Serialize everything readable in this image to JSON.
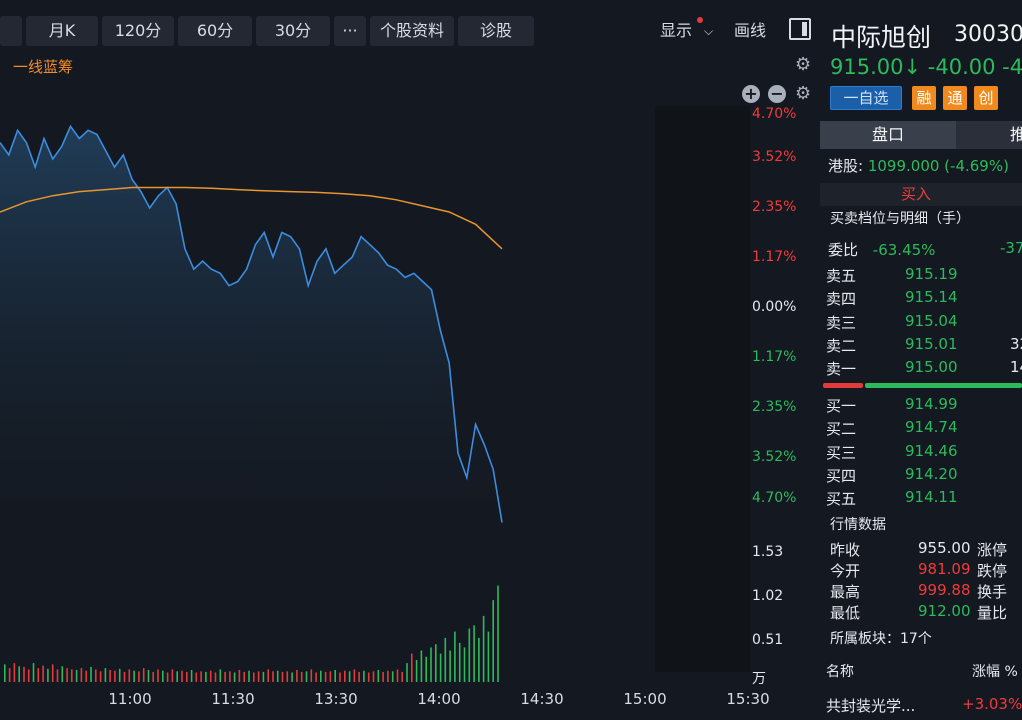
{
  "toolbar": {
    "buttons": [
      "月K",
      "120分",
      "60分",
      "30分",
      "···",
      "个股资料",
      "诊股"
    ],
    "display_label": "显示",
    "draw_label": "画线"
  },
  "chart": {
    "indicator_label": "一线蓝筹",
    "pct_labels": [
      {
        "text": "4.70%",
        "color": "red"
      },
      {
        "text": "3.52%",
        "color": "red"
      },
      {
        "text": "2.35%",
        "color": "red"
      },
      {
        "text": "1.17%",
        "color": "red"
      },
      {
        "text": "0.00%",
        "color": "white"
      },
      {
        "text": "1.17%",
        "color": "green"
      },
      {
        "text": "2.35%",
        "color": "green"
      },
      {
        "text": "3.52%",
        "color": "green"
      },
      {
        "text": "4.70%",
        "color": "green"
      }
    ],
    "volume_labels": [
      "1.53",
      "1.02",
      "0.51",
      "万"
    ],
    "time_labels": [
      "11:00",
      "11:30",
      "13:30",
      "14:00",
      "14:30",
      "15:00",
      "15:30"
    ]
  },
  "chart_data": {
    "type": "line",
    "title": "",
    "xlabel": "",
    "ylabel": "",
    "y_unit": "%",
    "ylim": [
      -4.7,
      4.7
    ],
    "x_ticks": [
      "11:00",
      "11:30",
      "13:30",
      "14:00",
      "14:30",
      "15:00",
      "15:30"
    ],
    "y_ticks": [
      4.7,
      3.52,
      2.35,
      1.17,
      0.0,
      -1.17,
      -2.35,
      -3.52,
      -4.7
    ],
    "series": [
      {
        "color": "#3b8de0",
        "values": [
          4.0,
          3.7,
          4.3,
          4.0,
          3.4,
          4.1,
          3.6,
          3.9,
          4.4,
          4.1,
          4.3,
          4.2,
          3.8,
          3.4,
          3.7,
          3.1,
          2.8,
          2.4,
          2.7,
          2.9,
          2.5,
          1.4,
          0.9,
          1.1,
          0.9,
          0.8,
          0.5,
          0.6,
          0.9,
          1.5,
          1.8,
          1.2,
          1.8,
          1.7,
          1.4,
          0.5,
          1.1,
          1.4,
          0.8,
          1.0,
          1.2,
          1.7,
          1.5,
          1.3,
          1.0,
          0.9,
          0.7,
          0.8,
          0.6,
          0.4,
          -0.6,
          -1.4,
          -3.6,
          -4.2,
          -2.9,
          -3.4,
          -4.0,
          -5.3
        ]
      },
      {
        "color": "#e8952e",
        "values": [
          2.3,
          2.55,
          2.7,
          2.8,
          2.85,
          2.9,
          2.9,
          2.9,
          2.88,
          2.85,
          2.82,
          2.8,
          2.78,
          2.75,
          2.7,
          2.6,
          2.45,
          2.3,
          2.0,
          1.4
        ]
      }
    ],
    "volume_series": {
      "ylim": [
        0,
        2.0
      ],
      "unit": "万",
      "values": [
        0.28,
        0.22,
        0.3,
        0.25,
        0.24,
        0.2,
        0.3,
        0.22,
        0.26,
        0.21,
        0.28,
        0.2,
        0.25,
        0.22,
        0.2,
        0.19,
        0.22,
        0.18,
        0.24,
        0.2,
        0.17,
        0.22,
        0.19,
        0.18,
        0.21,
        0.16,
        0.2,
        0.18,
        0.17,
        0.22,
        0.19,
        0.16,
        0.2,
        0.18,
        0.15,
        0.2,
        0.17,
        0.18,
        0.16,
        0.19,
        0.15,
        0.17,
        0.16,
        0.18,
        0.15,
        0.2,
        0.16,
        0.17,
        0.15,
        0.19,
        0.16,
        0.18,
        0.15,
        0.17,
        0.16,
        0.2,
        0.17,
        0.18,
        0.16,
        0.17,
        0.15,
        0.19,
        0.16,
        0.17,
        0.2,
        0.15,
        0.18,
        0.16,
        0.17,
        0.19,
        0.15,
        0.18,
        0.17,
        0.2,
        0.16,
        0.18,
        0.15,
        0.17,
        0.19,
        0.16,
        0.18,
        0.17,
        0.2,
        0.16,
        0.3,
        0.45,
        0.35,
        0.5,
        0.4,
        0.55,
        0.6,
        0.45,
        0.7,
        0.5,
        0.8,
        0.62,
        0.55,
        0.85,
        0.9,
        0.7,
        1.05,
        0.8,
        1.3,
        1.53
      ]
    }
  },
  "panel": {
    "stock_name": "中际旭创",
    "stock_code": "30030",
    "price": "915.00↓",
    "change": "-40.00",
    "change_pct": "-4.",
    "watch_button": "一自选",
    "tags": [
      "融",
      "通",
      "创"
    ],
    "tab_active": "盘口",
    "tab_next": "推",
    "hk_label": "港股:",
    "hk_value": "1099.000 (-4.69%)",
    "buy_button": "买入",
    "depth_title": "买卖档位与明细（手）",
    "ratio_label": "委比",
    "ratio_value": "-63.45%",
    "ratio_extra": "-37",
    "asks": [
      {
        "label": "卖五",
        "price": "915.19",
        "vol": ""
      },
      {
        "label": "卖四",
        "price": "915.14",
        "vol": ""
      },
      {
        "label": "卖三",
        "price": "915.04",
        "vol": ""
      },
      {
        "label": "卖二",
        "price": "915.01",
        "vol": "32"
      },
      {
        "label": "卖一",
        "price": "915.00",
        "vol": "14"
      }
    ],
    "bids": [
      {
        "label": "买一",
        "price": "914.99",
        "vol": ""
      },
      {
        "label": "买二",
        "price": "914.74",
        "vol": ""
      },
      {
        "label": "买三",
        "price": "914.46",
        "vol": ""
      },
      {
        "label": "买四",
        "price": "914.20",
        "vol": ""
      },
      {
        "label": "买五",
        "price": "914.11",
        "vol": ""
      }
    ],
    "quote_title": "行情数据",
    "quotes": [
      {
        "label": "昨收",
        "value": "955.00",
        "color": "w",
        "label2": "涨停"
      },
      {
        "label": "今开",
        "value": "981.09",
        "color": "r",
        "label2": "跌停"
      },
      {
        "label": "最高",
        "value": "999.88",
        "color": "r",
        "label2": "换手"
      },
      {
        "label": "最低",
        "value": "912.00",
        "color": "g",
        "label2": "量比"
      }
    ],
    "sector_title": "所属板块：17个",
    "col_name": "名称",
    "col_change": "涨幅 %",
    "sector_name": "共封装光学...",
    "sector_change": "+3.03%"
  }
}
